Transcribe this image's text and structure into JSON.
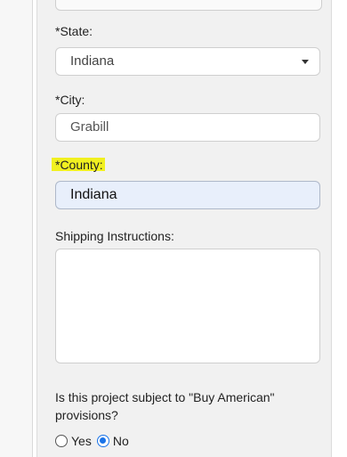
{
  "form": {
    "state": {
      "label": "*State:",
      "value": "Indiana"
    },
    "city": {
      "label": "*City:",
      "value": "Grabill"
    },
    "county": {
      "label": "*County:",
      "value": "Indiana"
    },
    "shipping": {
      "label": "Shipping Instructions:",
      "value": ""
    },
    "buy_american": {
      "question": "Is this project subject to \"Buy American\" provisions?",
      "options": [
        "Yes",
        "No"
      ],
      "selected": "No"
    }
  },
  "colors": {
    "highlight": "#f1f020",
    "focused_field_bg": "#e8effb",
    "radio_selected": "#1a73e8"
  }
}
